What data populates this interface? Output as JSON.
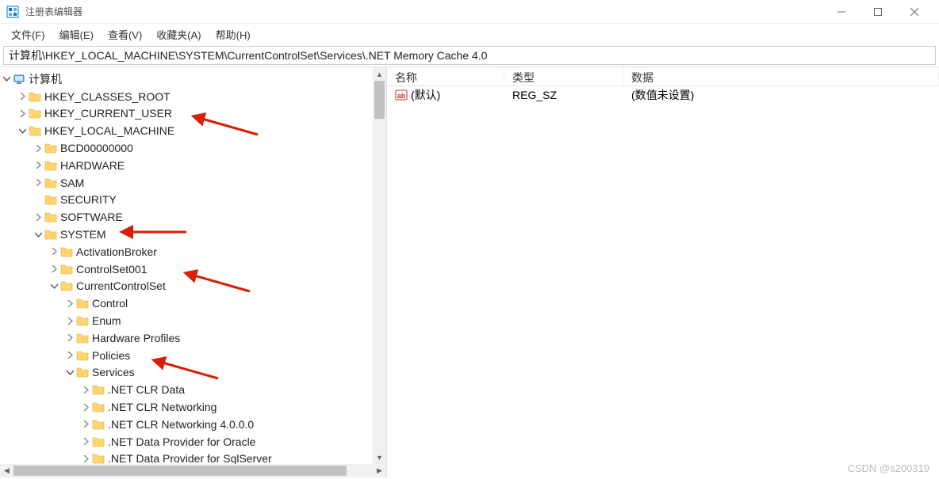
{
  "window": {
    "title": "注册表编辑器"
  },
  "menu": {
    "file": "文件(F)",
    "edit": "编辑(E)",
    "view": "查看(V)",
    "favorites": "收藏夹(A)",
    "help": "帮助(H)"
  },
  "address": "计算机\\HKEY_LOCAL_MACHINE\\SYSTEM\\CurrentControlSet\\Services\\.NET Memory Cache 4.0",
  "tree": [
    {
      "depth": 0,
      "exp": "open",
      "icon": "pc",
      "label": "计算机"
    },
    {
      "depth": 1,
      "exp": "closed",
      "icon": "folder",
      "label": "HKEY_CLASSES_ROOT"
    },
    {
      "depth": 1,
      "exp": "closed",
      "icon": "folder",
      "label": "HKEY_CURRENT_USER"
    },
    {
      "depth": 1,
      "exp": "open",
      "icon": "folder",
      "label": "HKEY_LOCAL_MACHINE"
    },
    {
      "depth": 2,
      "exp": "closed",
      "icon": "folder",
      "label": "BCD00000000"
    },
    {
      "depth": 2,
      "exp": "closed",
      "icon": "folder",
      "label": "HARDWARE"
    },
    {
      "depth": 2,
      "exp": "closed",
      "icon": "folder",
      "label": "SAM"
    },
    {
      "depth": 2,
      "exp": "none",
      "icon": "folder",
      "label": "SECURITY"
    },
    {
      "depth": 2,
      "exp": "closed",
      "icon": "folder",
      "label": "SOFTWARE"
    },
    {
      "depth": 2,
      "exp": "open",
      "icon": "folder",
      "label": "SYSTEM"
    },
    {
      "depth": 3,
      "exp": "closed",
      "icon": "folder",
      "label": "ActivationBroker"
    },
    {
      "depth": 3,
      "exp": "closed",
      "icon": "folder",
      "label": "ControlSet001"
    },
    {
      "depth": 3,
      "exp": "open",
      "icon": "folder",
      "label": "CurrentControlSet"
    },
    {
      "depth": 4,
      "exp": "closed",
      "icon": "folder",
      "label": "Control"
    },
    {
      "depth": 4,
      "exp": "closed",
      "icon": "folder",
      "label": "Enum"
    },
    {
      "depth": 4,
      "exp": "closed",
      "icon": "folder",
      "label": "Hardware Profiles"
    },
    {
      "depth": 4,
      "exp": "closed",
      "icon": "folder",
      "label": "Policies"
    },
    {
      "depth": 4,
      "exp": "open",
      "icon": "folder",
      "label": "Services"
    },
    {
      "depth": 5,
      "exp": "closed",
      "icon": "folder",
      "label": ".NET CLR Data"
    },
    {
      "depth": 5,
      "exp": "closed",
      "icon": "folder",
      "label": ".NET CLR Networking"
    },
    {
      "depth": 5,
      "exp": "closed",
      "icon": "folder",
      "label": ".NET CLR Networking 4.0.0.0"
    },
    {
      "depth": 5,
      "exp": "closed",
      "icon": "folder",
      "label": ".NET Data Provider for Oracle"
    },
    {
      "depth": 5,
      "exp": "closed",
      "icon": "folder",
      "label": ".NET Data Provider for SqlServer"
    }
  ],
  "list": {
    "headers": {
      "name": "名称",
      "type": "类型",
      "data": "数据"
    },
    "rows": [
      {
        "name": "(默认)",
        "type": "REG_SZ",
        "data": "(数值未设置)"
      }
    ]
  },
  "watermark": "CSDN @s200319"
}
